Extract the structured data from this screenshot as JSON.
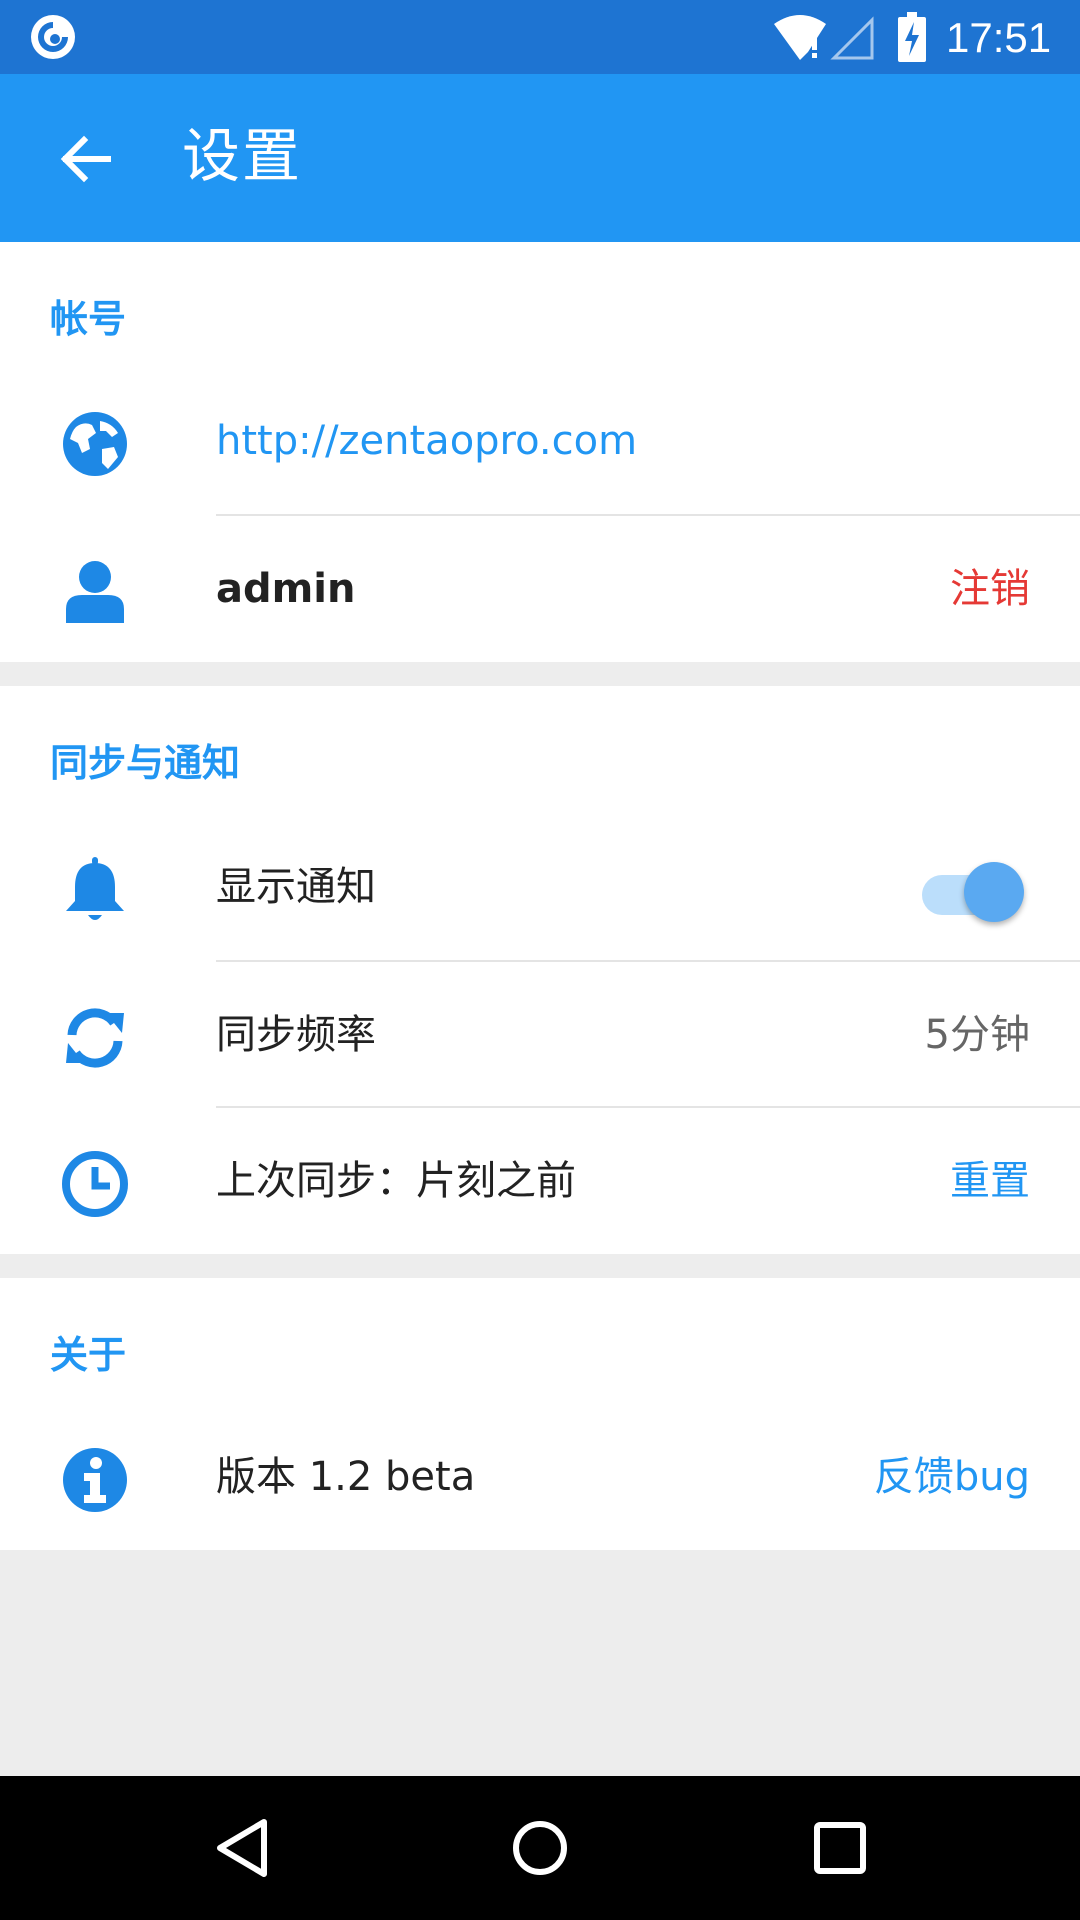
{
  "status_bar": {
    "time": "17:51",
    "icons": [
      "app-logo-icon",
      "wifi-alert-icon",
      "signal-empty-icon",
      "battery-charging-icon"
    ]
  },
  "app_bar": {
    "title": "设置",
    "back_icon": "arrow-back-icon"
  },
  "colors": {
    "status_bar": "#1E74D2",
    "app_bar": "#2196F3",
    "accent": "#2196F3",
    "danger": "#E53935",
    "background": "#EDEDED"
  },
  "account": {
    "header": "帐号",
    "server_url": "http://zentaopro.com",
    "username": "admin",
    "logout_label": "注销"
  },
  "sync": {
    "header": "同步与通知",
    "notify_label": "显示通知",
    "notify_enabled": true,
    "frequency_label": "同步频率",
    "frequency_value": "5分钟",
    "last_sync_label": "上次同步：片刻之前",
    "reset_label": "重置"
  },
  "about": {
    "header": "关于",
    "version_label": "版本 1.2 beta",
    "feedback_label": "反馈bug"
  },
  "nav_bar": {
    "buttons": [
      "back-triangle-icon",
      "home-circle-icon",
      "recents-square-icon"
    ]
  }
}
